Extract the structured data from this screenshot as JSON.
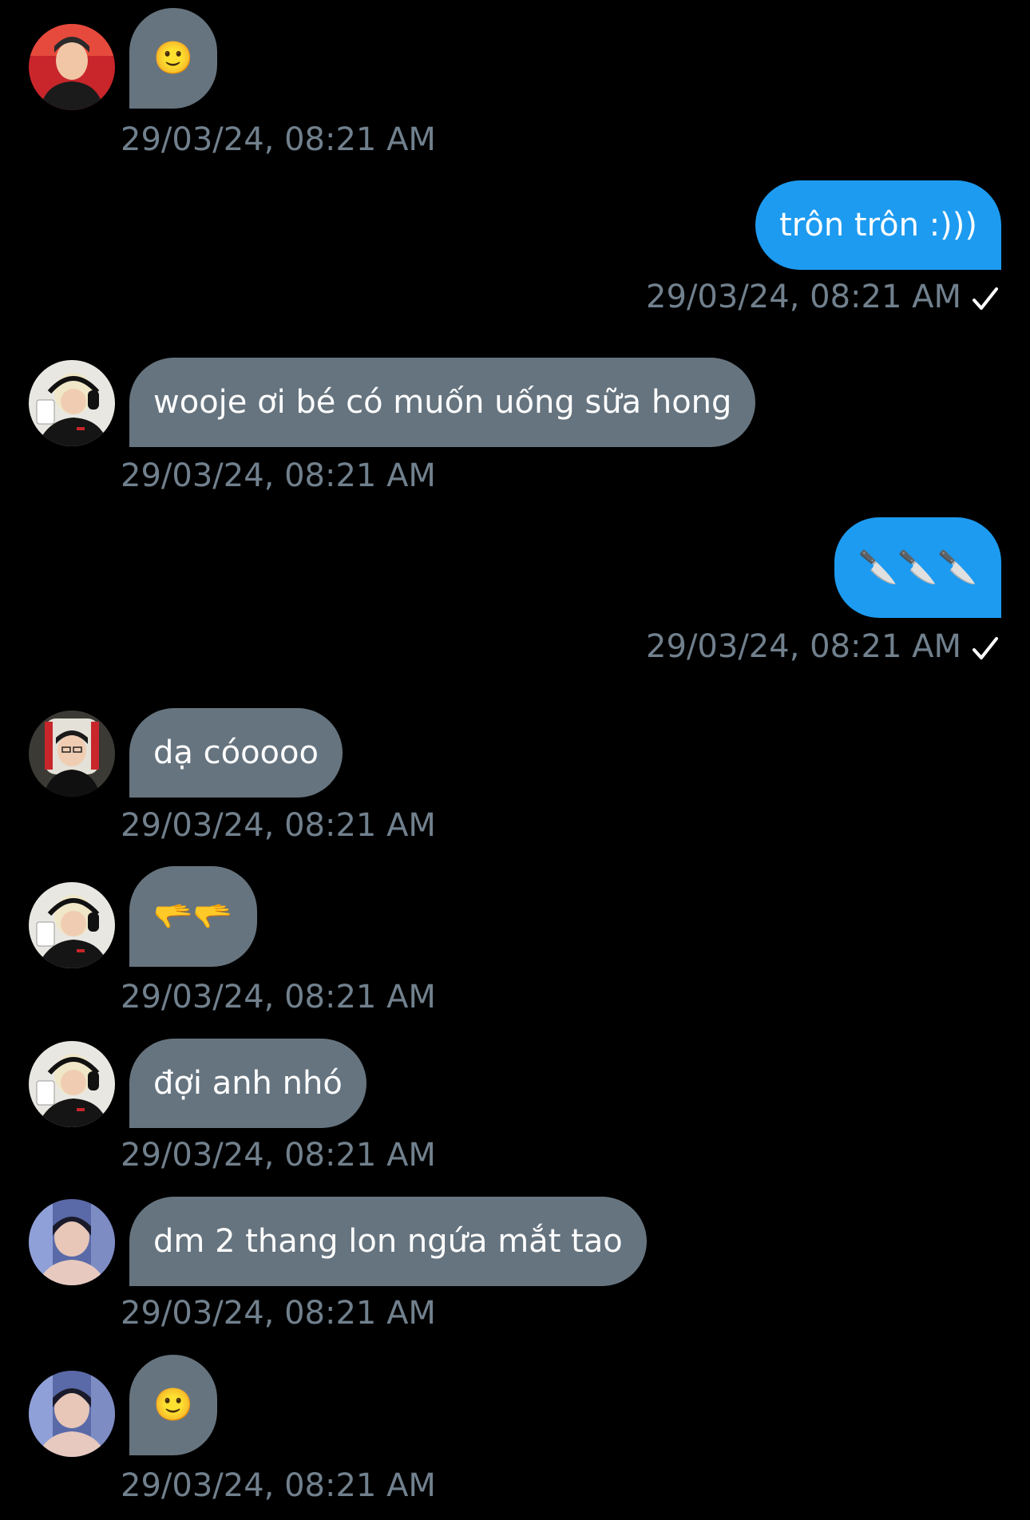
{
  "messages": [
    {
      "side": "in",
      "avatar": "avatar-red-background",
      "text": "🙂",
      "timestamp": "29/03/24, 08:21 AM"
    },
    {
      "side": "out",
      "text": "trôn trôn :)))",
      "timestamp": "29/03/24, 08:21 AM",
      "status_icon": "check-icon"
    },
    {
      "side": "in",
      "avatar": "avatar-headset-drinking",
      "text": "wooje ơi bé có muốn uống sữa hong",
      "timestamp": "29/03/24, 08:21 AM"
    },
    {
      "side": "out",
      "text": "🔪🔪🔪",
      "timestamp": "29/03/24, 08:21 AM",
      "status_icon": "check-icon"
    },
    {
      "side": "in",
      "avatar": "avatar-gaming-chair",
      "text": "dạ cóoooo",
      "timestamp": "29/03/24, 08:21 AM"
    },
    {
      "side": "in",
      "avatar": "avatar-headset-drinking",
      "text": "🫳🫳",
      "timestamp": "29/03/24, 08:21 AM"
    },
    {
      "side": "in",
      "avatar": "avatar-headset-drinking",
      "text": "đợi anh nhó",
      "timestamp": "29/03/24, 08:21 AM"
    },
    {
      "side": "in",
      "avatar": "avatar-blue-room",
      "text": "dm 2 thang lon ngứa mắt tao",
      "timestamp": "29/03/24, 08:21 AM"
    },
    {
      "side": "in",
      "avatar": "avatar-blue-room",
      "text": "🙂",
      "timestamp": "29/03/24, 08:21 AM"
    }
  ],
  "colors": {
    "background": "#000000",
    "incoming_bubble": "#66747f",
    "outgoing_bubble": "#1d9bf0",
    "timestamp": "#71808d",
    "text": "#ffffff"
  }
}
